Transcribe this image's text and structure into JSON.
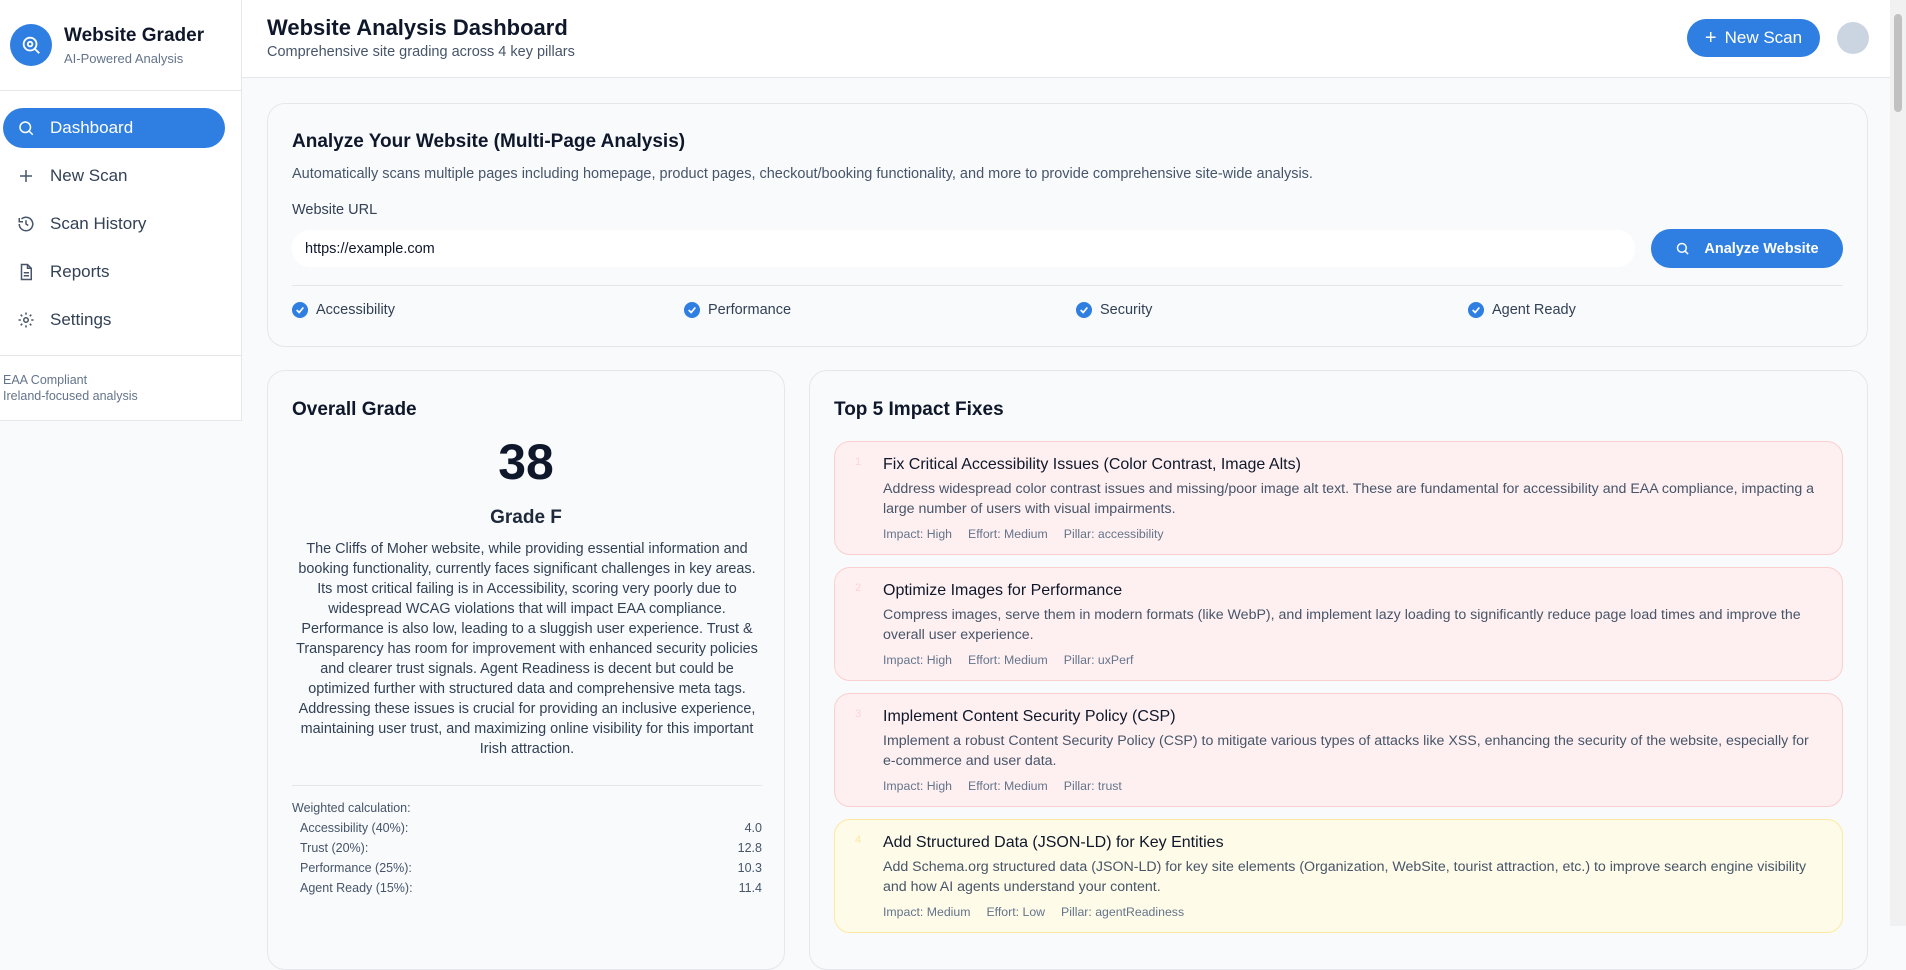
{
  "sidebar": {
    "brand_title": "Website Grader",
    "brand_subtitle": "AI-Powered Analysis",
    "items": [
      {
        "label": "Dashboard",
        "icon": "search-icon",
        "active": true
      },
      {
        "label": "New Scan",
        "icon": "plus-icon",
        "active": false
      },
      {
        "label": "Scan History",
        "icon": "history-icon",
        "active": false
      },
      {
        "label": "Reports",
        "icon": "document-icon",
        "active": false
      },
      {
        "label": "Settings",
        "icon": "gear-icon",
        "active": false
      }
    ],
    "footer_line1": "EAA Compliant",
    "footer_line2": "Ireland-focused analysis"
  },
  "header": {
    "title": "Website Analysis Dashboard",
    "subtitle": "Comprehensive site grading across 4 key pillars",
    "new_scan_label": "New Scan"
  },
  "analyze": {
    "title": "Analyze Your Website (Multi-Page Analysis)",
    "description": "Automatically scans multiple pages including homepage, product pages, checkout/booking functionality, and more to provide comprehensive site-wide analysis.",
    "url_label": "Website URL",
    "url_value": "https://example.com",
    "button_label": "Analyze Website",
    "pillars": [
      "Accessibility",
      "Performance",
      "Security",
      "Agent Ready"
    ]
  },
  "overall": {
    "title": "Overall Grade",
    "score": "38",
    "grade": "Grade F",
    "summary": "The Cliffs of Moher website, while providing essential information and booking functionality, currently faces significant challenges in key areas. Its most critical failing is in Accessibility, scoring very poorly due to widespread WCAG violations that will impact EAA compliance. Performance is also low, leading to a sluggish user experience. Trust & Transparency has room for improvement with enhanced security policies and clearer trust signals. Agent Readiness is decent but could be optimized further with structured data and comprehensive meta tags. Addressing these issues is crucial for providing an inclusive experience, maintaining user trust, and maximizing online visibility for this important Irish attraction.",
    "weighted_title": "Weighted calculation:",
    "weighted": [
      {
        "label": "Accessibility (40%):",
        "value": "4.0"
      },
      {
        "label": "Trust (20%):",
        "value": "12.8"
      },
      {
        "label": "Performance (25%):",
        "value": "10.3"
      },
      {
        "label": "Agent Ready (15%):",
        "value": "11.4"
      }
    ]
  },
  "fixes": {
    "title": "Top 5 Impact Fixes",
    "items": [
      {
        "num": "1",
        "title": "Fix Critical Accessibility Issues (Color Contrast, Image Alts)",
        "desc": "Address widespread color contrast issues and missing/poor image alt text. These are fundamental for accessibility and EAA compliance, impacting a large number of users with visual impairments.",
        "impact": "Impact: High",
        "effort": "Effort: Medium",
        "pillar": "Pillar: accessibility",
        "color": "#fef0f0"
      },
      {
        "num": "2",
        "title": "Optimize Images for Performance",
        "desc": "Compress images, serve them in modern formats (like WebP), and implement lazy loading to significantly reduce page load times and improve the overall user experience.",
        "impact": "Impact: High",
        "effort": "Effort: Medium",
        "pillar": "Pillar: uxPerf",
        "color": "#fef0f0"
      },
      {
        "num": "3",
        "title": "Implement Content Security Policy (CSP)",
        "desc": "Implement a robust Content Security Policy (CSP) to mitigate various types of attacks like XSS, enhancing the security of the website, especially for e-commerce and user data.",
        "impact": "Impact: High",
        "effort": "Effort: Medium",
        "pillar": "Pillar: trust",
        "color": "#fef0f0"
      },
      {
        "num": "4",
        "title": "Add Structured Data (JSON-LD) for Key Entities",
        "desc": "Add Schema.org structured data (JSON-LD) for key site elements (Organization, WebSite, tourist attraction, etc.) to improve search engine visibility and how AI agents understand your content.",
        "impact": "Impact: Medium",
        "effort": "Effort: Low",
        "pillar": "Pillar: agentReadiness",
        "color": "#fefbe8"
      }
    ]
  },
  "colors": {
    "accent": "#2f7ee2",
    "high_impact_bg": "#fef0f0",
    "medium_impact_bg": "#fefbe8"
  }
}
